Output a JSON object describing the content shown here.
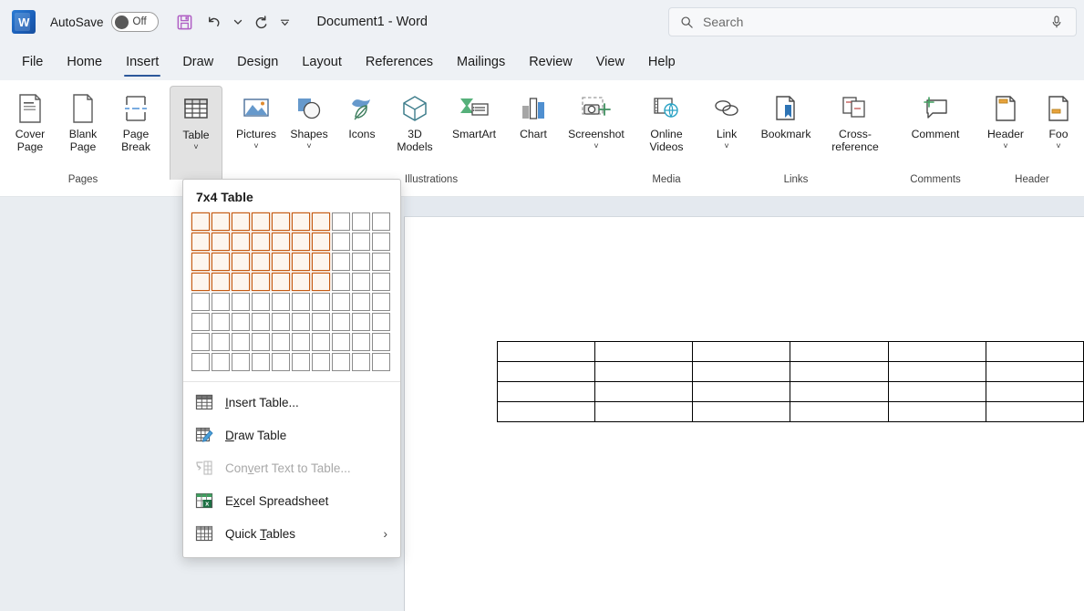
{
  "titlebar": {
    "app_logo": "word-logo",
    "logo_letter": "W",
    "autosave_label": "AutoSave",
    "autosave_state": "Off",
    "save_icon": "save-icon",
    "undo_icon": "undo-icon",
    "undo_dropdown_icon": "chevron-down-icon",
    "redo_icon": "redo-icon",
    "customize_qat_icon": "customize-quick-access-toolbar-icon",
    "document_title": "Document1  -  Word"
  },
  "search": {
    "placeholder": "Search",
    "icon": "search-icon",
    "mic_icon": "microphone-icon"
  },
  "tabs": [
    {
      "label": "File",
      "active": false
    },
    {
      "label": "Home",
      "active": false
    },
    {
      "label": "Insert",
      "active": true
    },
    {
      "label": "Draw",
      "active": false
    },
    {
      "label": "Design",
      "active": false
    },
    {
      "label": "Layout",
      "active": false
    },
    {
      "label": "References",
      "active": false
    },
    {
      "label": "Mailings",
      "active": false
    },
    {
      "label": "Review",
      "active": false
    },
    {
      "label": "View",
      "active": false
    },
    {
      "label": "Help",
      "active": false
    }
  ],
  "ribbon": {
    "groups": [
      {
        "name": "Pages",
        "label": "Pages",
        "buttons": [
          {
            "label": "Cover\nPage",
            "icon": "cover-page-icon",
            "chevron": true,
            "inline_chevron": true
          },
          {
            "label": "Blank\nPage",
            "icon": "blank-page-icon",
            "chevron": false
          },
          {
            "label": "Page\nBreak",
            "icon": "page-break-icon",
            "chevron": false
          }
        ]
      },
      {
        "name": "Tables",
        "label": "",
        "buttons": [
          {
            "label": "Table",
            "icon": "table-icon",
            "chevron": true,
            "active": true
          }
        ]
      },
      {
        "name": "Illustrations",
        "label": "Illustrations",
        "buttons": [
          {
            "label": "Pictures",
            "icon": "pictures-icon",
            "chevron": true
          },
          {
            "label": "Shapes",
            "icon": "shapes-icon",
            "chevron": true
          },
          {
            "label": "Icons",
            "icon": "icons-icon",
            "chevron": false
          },
          {
            "label": "3D\nModels",
            "icon": "3d-models-icon",
            "chevron": true,
            "inline_chevron": true
          },
          {
            "label": "SmartArt",
            "icon": "smartart-icon",
            "chevron": false
          },
          {
            "label": "Chart",
            "icon": "chart-icon",
            "chevron": false
          },
          {
            "label": "Screenshot",
            "icon": "screenshot-icon",
            "chevron": true
          }
        ]
      },
      {
        "name": "Media",
        "label": "Media",
        "buttons": [
          {
            "label": "Online\nVideos",
            "icon": "online-videos-icon",
            "chevron": false
          }
        ]
      },
      {
        "name": "Links",
        "label": "Links",
        "buttons": [
          {
            "label": "Link",
            "icon": "link-icon",
            "chevron": true
          },
          {
            "label": "Bookmark",
            "icon": "bookmark-icon",
            "chevron": false
          },
          {
            "label": "Cross-\nreference",
            "icon": "cross-reference-icon",
            "chevron": false
          }
        ]
      },
      {
        "name": "Comments",
        "label": "Comments",
        "buttons": [
          {
            "label": "Comment",
            "icon": "comment-icon",
            "chevron": false
          }
        ]
      },
      {
        "name": "Header",
        "label": "Header",
        "buttons": [
          {
            "label": "Header",
            "icon": "header-icon",
            "chevron": true
          },
          {
            "label": "Foo",
            "icon": "footer-icon",
            "chevron": true
          }
        ]
      }
    ]
  },
  "table_dropdown": {
    "title": "7x4 Table",
    "grid": {
      "columns": 10,
      "rows": 8,
      "selected_columns": 7,
      "selected_rows": 4
    },
    "selection_color": "#c55a11",
    "menu_items": [
      {
        "label": "Insert Table...",
        "accel": "I",
        "icon": "insert-table-icon",
        "disabled": false,
        "submenu": false
      },
      {
        "label": "Draw Table",
        "accel": "D",
        "icon": "draw-table-icon",
        "disabled": false,
        "submenu": false
      },
      {
        "label": "Convert Text to Table...",
        "accel": "v",
        "icon": "convert-text-to-table-icon",
        "disabled": true,
        "submenu": false
      },
      {
        "label": "Excel Spreadsheet",
        "accel": "x",
        "icon": "excel-spreadsheet-icon",
        "disabled": false,
        "submenu": false
      },
      {
        "label": "Quick Tables",
        "accel": "T",
        "icon": "quick-tables-icon",
        "disabled": false,
        "submenu": true
      }
    ],
    "submenu_arrow": "›"
  },
  "document": {
    "preview_table": {
      "rows": 4,
      "columns": 6
    }
  }
}
